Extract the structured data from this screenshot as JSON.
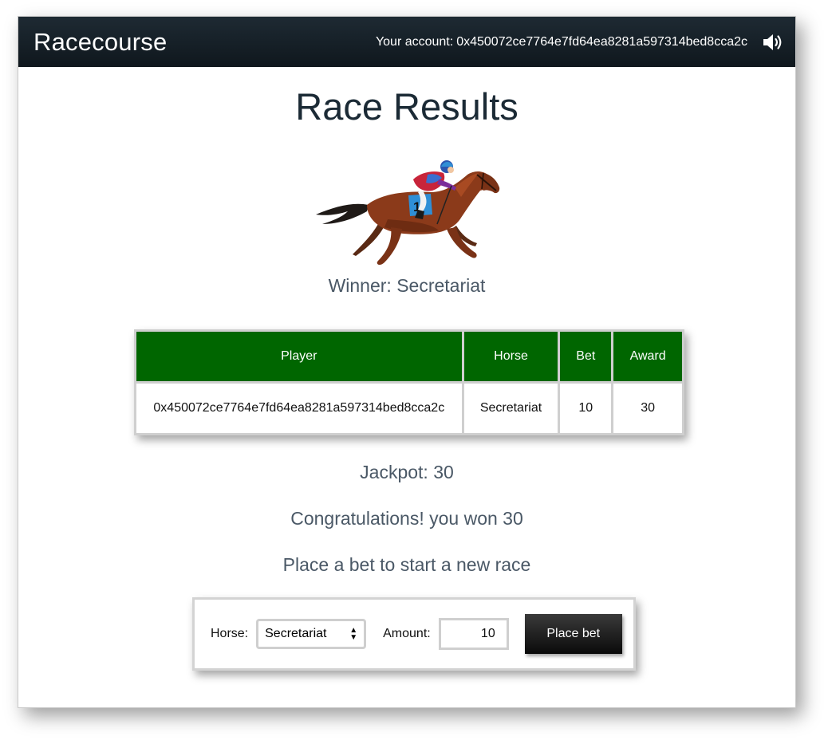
{
  "navbar": {
    "brand": "Racecourse",
    "account_label": "Your account:",
    "account_address": "0x450072ce7764e7fd64ea8281a597314bed8cca2c",
    "sound_icon": "speaker-volume-icon"
  },
  "main": {
    "title": "Race Results",
    "horse_image": "racehorse-with-jockey-number-1",
    "winner_text": "Winner: Secretariat"
  },
  "results_table": {
    "headers": [
      "Player",
      "Horse",
      "Bet",
      "Award"
    ],
    "rows": [
      {
        "player": "0x450072ce7764e7fd64ea8281a597314bed8cca2c",
        "horse": "Secretariat",
        "bet": "10",
        "award": "30"
      }
    ],
    "header_color": "#006600"
  },
  "status": {
    "jackpot": "Jackpot: 30",
    "congrats": "Congratulations! you won 30",
    "prompt": "Place a bet to start a new race"
  },
  "bet_form": {
    "horse_label": "Horse:",
    "horse_selected": "Secretariat",
    "amount_label": "Amount:",
    "amount_value": "10",
    "submit_label": "Place bet"
  }
}
